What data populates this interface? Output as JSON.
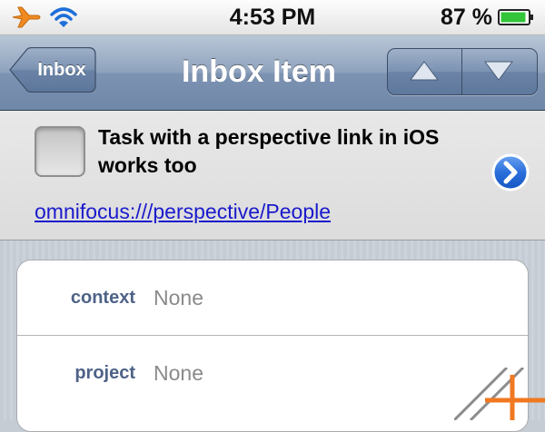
{
  "status_bar": {
    "time": "4:53 PM",
    "battery_percent": "87 %",
    "icons": [
      "airplane-icon",
      "wifi-icon",
      "battery-icon"
    ]
  },
  "nav": {
    "back_label": "Inbox",
    "title": "Inbox Item",
    "prev_icon": "triangle-up-icon",
    "next_icon": "triangle-down-icon"
  },
  "task": {
    "title": "Task with a perspective link in iOS works too",
    "link": "omnifocus:///perspective/People",
    "completed": false
  },
  "fields": {
    "context": {
      "label": "context",
      "value": "None"
    },
    "project": {
      "label": "project",
      "value": "None"
    }
  },
  "colors": {
    "nav_tint": "#7d93b2",
    "link": "#1a1acc",
    "label": "#4e6287",
    "value": "#8a8a8a",
    "accent_orange": "#f07820",
    "disclosure_blue": "#2a6fdb"
  }
}
